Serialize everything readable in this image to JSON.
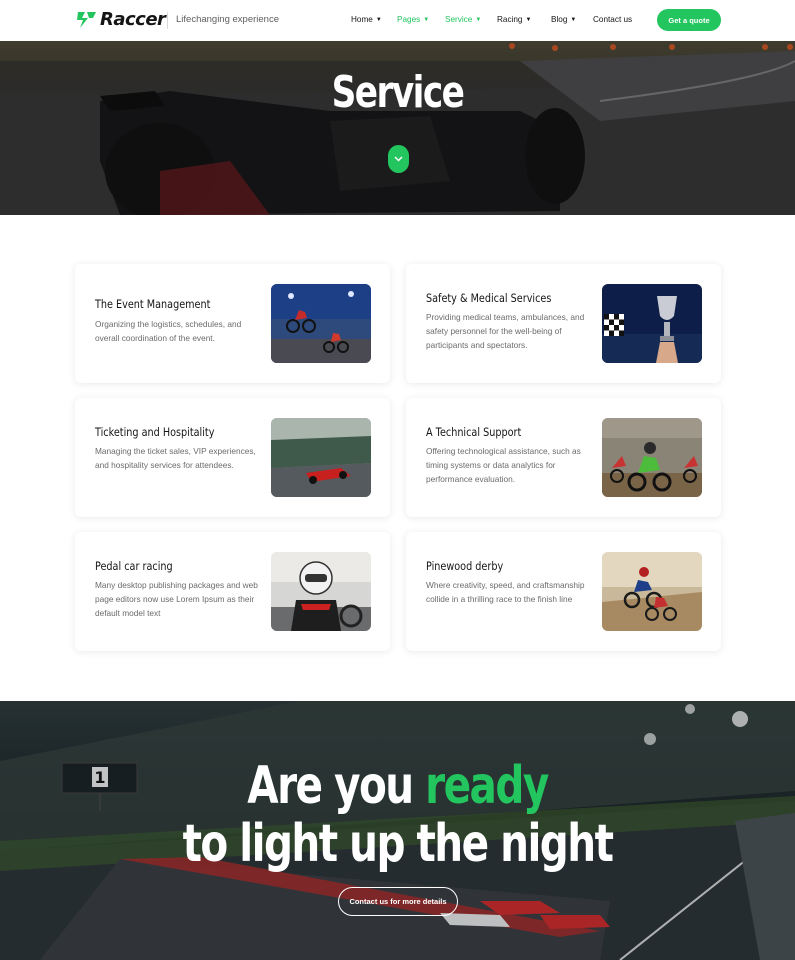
{
  "brand": {
    "name": "Raccer",
    "tagline": "Lifechanging experience",
    "accent_color": "#22c55e"
  },
  "nav": {
    "items": [
      {
        "label": "Home",
        "has_dropdown": true,
        "active": false
      },
      {
        "label": "Pages",
        "has_dropdown": true,
        "active": false
      },
      {
        "label": "Service",
        "has_dropdown": true,
        "active": true
      },
      {
        "label": "Racing",
        "has_dropdown": true,
        "active": false
      },
      {
        "label": "Blog",
        "has_dropdown": true,
        "active": false
      },
      {
        "label": "Contact us",
        "has_dropdown": false,
        "active": false
      }
    ],
    "cta_label": "Get a quote"
  },
  "hero": {
    "title": "Service",
    "scroll_icon": "chevron-down-icon"
  },
  "services": [
    {
      "title": "The Event Management",
      "description": "Organizing the logistics, schedules, and overall coordination of the event.",
      "image": "motocross-stadium-image"
    },
    {
      "title": "Safety & Medical Services",
      "description": "Providing medical teams, ambulances, and safety personnel for the well-being of participants and spectators.",
      "image": "trophy-checkered-flag-image"
    },
    {
      "title": "Ticketing and Hospitality",
      "description": "Managing the ticket sales, VIP experiences, and hospitality services for attendees.",
      "image": "formula-car-track-image"
    },
    {
      "title": "A Technical Support",
      "description": "Offering technological assistance, such as timing systems or data analytics for performance evaluation.",
      "image": "dirt-bike-race-image"
    },
    {
      "title": "Pedal car racing",
      "description": "Many desktop publishing packages and web page editors now use Lorem Ipsum as their default model text",
      "image": "kart-driver-helmet-image"
    },
    {
      "title": "Pinewood derby",
      "description": "Where creativity, speed, and craftsmanship collide in a thrilling race to the finish line",
      "image": "desert-dirt-bike-image"
    }
  ],
  "cta_section": {
    "line1_prefix": "Are you",
    "line1_accent": "ready",
    "line2": "to light up the night",
    "button_label": "Contact us for more details",
    "scoreboard_number": "1"
  }
}
